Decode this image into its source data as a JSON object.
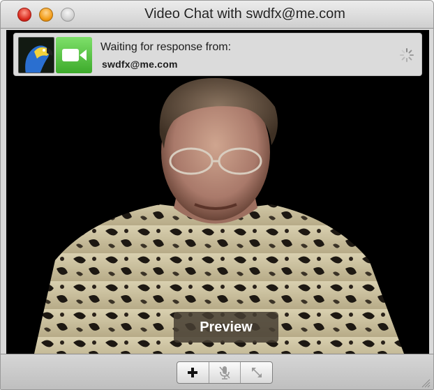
{
  "window": {
    "title": "Video Chat with swdfx@me.com"
  },
  "status": {
    "line1": "Waiting for response from:",
    "contact": "swdfx@me.com"
  },
  "preview": {
    "label": "Preview"
  },
  "toolbar": {
    "buttons": [
      {
        "name": "add-participant",
        "icon": "plus-icon"
      },
      {
        "name": "mute",
        "icon": "microphone-icon",
        "disabled": true
      },
      {
        "name": "fullscreen",
        "icon": "expand-arrows-icon",
        "disabled": true
      }
    ]
  },
  "colors": {
    "facetime_green": "#4cbc38",
    "close": "#d8281c",
    "minimize": "#f19a14"
  }
}
